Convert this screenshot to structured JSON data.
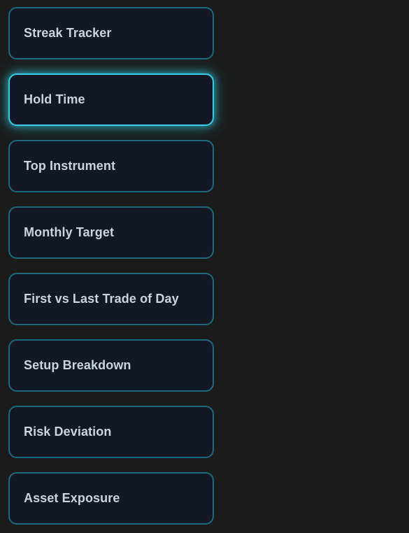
{
  "widgets": {
    "items": [
      {
        "label": "Streak Tracker",
        "active": false
      },
      {
        "label": "Hold Time",
        "active": true
      },
      {
        "label": "Top Instrument",
        "active": false
      },
      {
        "label": "Monthly Target",
        "active": false
      },
      {
        "label": "First vs Last Trade of Day",
        "active": false
      },
      {
        "label": "Setup Breakdown",
        "active": false
      },
      {
        "label": "Risk Deviation",
        "active": false
      },
      {
        "label": "Asset Exposure",
        "active": false
      }
    ]
  },
  "colors": {
    "background": "#1b1b1b",
    "card_background": "#141824",
    "card_border": "#1d6a80",
    "active_border": "#36cde6",
    "label_text": "#c9d3e2"
  }
}
